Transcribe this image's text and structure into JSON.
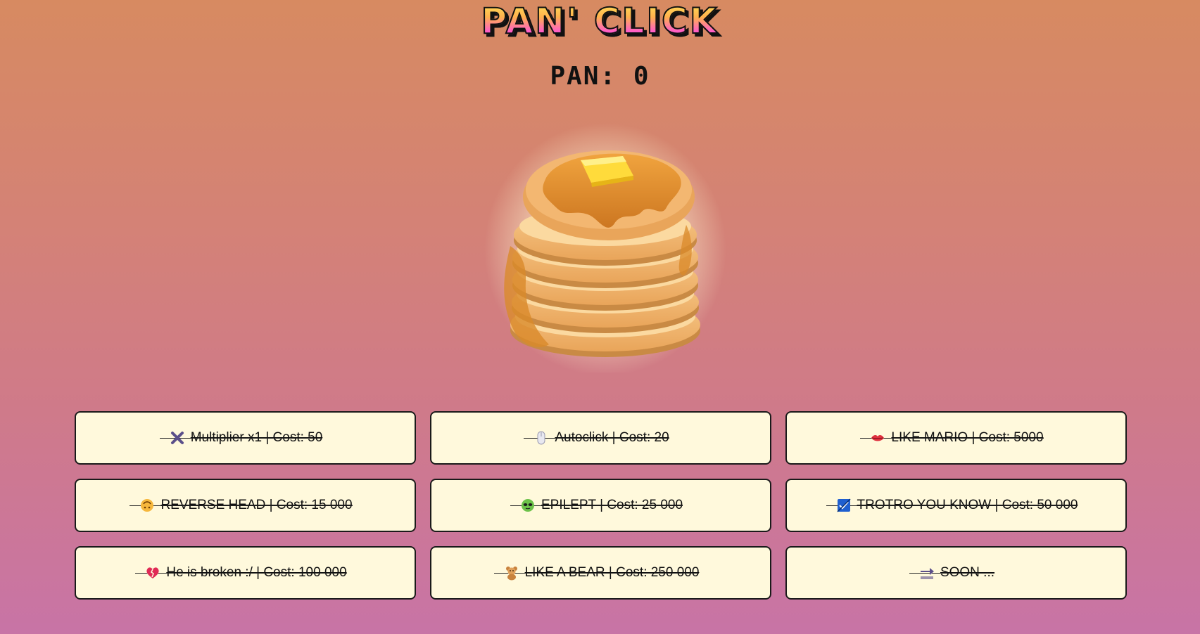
{
  "title": "PAN' CLICK",
  "score": {
    "label": "PAN:",
    "value": "0"
  },
  "shop": {
    "items": [
      {
        "icon": "multiply-icon",
        "label": "Multiplier x1 | Cost: 50"
      },
      {
        "icon": "mouse-icon",
        "label": "Autoclick | Cost: 20"
      },
      {
        "icon": "lips-icon",
        "label": "LIKE MARIO | Cost: 5000"
      },
      {
        "icon": "upside-down-face-icon",
        "label": "REVERSE HEAD | Cost: 15 000"
      },
      {
        "icon": "alien-face-icon",
        "label": "EPILEPT | Cost: 25 000"
      },
      {
        "icon": "check-square-icon",
        "label": "TROTRO YOU KNOW | Cost: 50 000"
      },
      {
        "icon": "broken-heart-icon",
        "label": "He is broken :/ | Cost: 100 000"
      },
      {
        "icon": "teddy-bear-icon",
        "label": "LIKE A BEAR | Cost: 250 000"
      },
      {
        "icon": "soon-arrow-icon",
        "label": "SOON ..."
      }
    ]
  },
  "colors": {
    "card_bg": "#fff9dc",
    "card_border": "#1a1a1a",
    "logo_top": "#ffe85a",
    "logo_bottom": "#ff3fd0"
  }
}
